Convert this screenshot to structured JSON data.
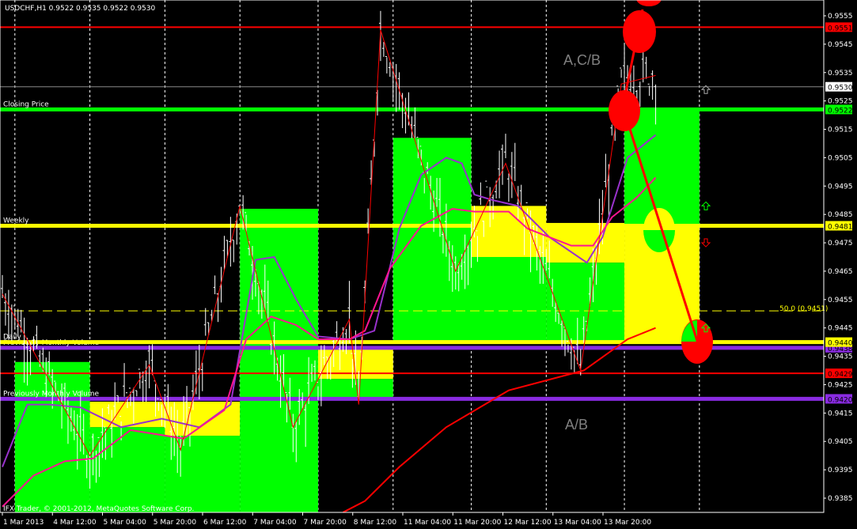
{
  "window": {
    "symbol_info": "USDCHF,H1  0.9522 0.9535 0.9522 0.9530",
    "copyright": "IFX Trader, © 2001-2012, MetaQuotes Software Corp."
  },
  "chart_data": {
    "type": "candlestick-bars",
    "symbol": "USDCHF",
    "timeframe": "H1",
    "ohlc_current": {
      "open": 0.9522,
      "high": 0.9535,
      "low": 0.9522,
      "close": 0.953
    },
    "ylim": [
      0.938,
      0.956
    ],
    "y_ticks": [
      "0.9555",
      "0.9545",
      "0.9535",
      "0.9525",
      "0.9515",
      "0.9505",
      "0.9495",
      "0.9485",
      "0.9475",
      "0.9465",
      "0.9455",
      "0.9445",
      "0.9435",
      "0.9425",
      "0.9415",
      "0.9405",
      "0.9395",
      "0.9385"
    ],
    "x_ticks": [
      "1 Mar 2013",
      "4 Mar 12:00",
      "5 Mar 04:00",
      "5 Mar 20:00",
      "6 Mar 12:00",
      "7 Mar 04:00",
      "7 Mar 20:00",
      "8 Mar 12:00",
      "11 Mar 04:00",
      "11 Mar 20:00",
      "12 Mar 12:00",
      "13 Mar 04:00",
      "13 Mar 20:00"
    ],
    "levels": [
      {
        "name": "resistance",
        "price": 0.9551,
        "label": "0.9551",
        "color": "#ff0000",
        "width": 2
      },
      {
        "name": "current-price",
        "price": 0.953,
        "label": "0.9530",
        "color": "#8a8a8a",
        "width": 1
      },
      {
        "name": "closing-price",
        "price": 0.9522,
        "label": "0.9522",
        "color": "#00ff00",
        "width": 5,
        "text": "Closing Price"
      },
      {
        "name": "weekly",
        "price": 0.9481,
        "label": "0.9481",
        "color": "#ffff00",
        "width": 5,
        "text": "Weekly"
      },
      {
        "name": "previous-monthly-volume-1",
        "price": 0.9438,
        "label": "0.9438",
        "color": "#8a2be2",
        "width": 5,
        "text": "Previously Monthly Volume"
      },
      {
        "name": "daily",
        "price": 0.944,
        "label": "0.9440",
        "color": "#ffff00",
        "width": 5,
        "text": "Daily"
      },
      {
        "name": "support",
        "price": 0.9429,
        "label": "0.9429",
        "color": "#ff0000",
        "width": 2
      },
      {
        "name": "previous-monthly-volume-2",
        "price": 0.942,
        "label": "0.9420",
        "color": "#8a2be2",
        "width": 5,
        "text": "Previously Monthly Volume"
      }
    ],
    "fibo": {
      "price": 0.9451,
      "label": "50.0 (0.9451)"
    },
    "boxes": [
      {
        "b0": 4,
        "b1": 28,
        "top": 0.9433,
        "bottom": 0.938,
        "color": "#00ff00"
      },
      {
        "b0": 28,
        "b1": 52,
        "top": 0.9419,
        "bottom": 0.941,
        "color": "#ffff00"
      },
      {
        "b0": 28,
        "b1": 52,
        "top": 0.941,
        "bottom": 0.938,
        "color": "#00ff00"
      },
      {
        "b0": 52,
        "b1": 76,
        "top": 0.9419,
        "bottom": 0.9407,
        "color": "#ffff00"
      },
      {
        "b0": 52,
        "b1": 76,
        "top": 0.9407,
        "bottom": 0.938,
        "color": "#00ff00"
      },
      {
        "b0": 76,
        "b1": 101,
        "top": 0.9487,
        "bottom": 0.938,
        "color": "#00ff00"
      },
      {
        "b0": 101,
        "b1": 125,
        "top": 0.9438,
        "bottom": 0.9427,
        "color": "#ffff00"
      },
      {
        "b0": 101,
        "b1": 125,
        "top": 0.9427,
        "bottom": 0.942,
        "color": "#00ff00"
      },
      {
        "b0": 125,
        "b1": 150,
        "top": 0.9512,
        "bottom": 0.944,
        "color": "#00ff00"
      },
      {
        "b0": 150,
        "b1": 174,
        "top": 0.9488,
        "bottom": 0.947,
        "color": "#ffff00"
      },
      {
        "b0": 150,
        "b1": 174,
        "top": 0.947,
        "bottom": 0.944,
        "color": "#00ff00"
      },
      {
        "b0": 174,
        "b1": 199,
        "top": 0.9482,
        "bottom": 0.9468,
        "color": "#ffff00"
      },
      {
        "b0": 174,
        "b1": 199,
        "top": 0.9468,
        "bottom": 0.944,
        "color": "#00ff00"
      },
      {
        "b0": 199,
        "b1": 223,
        "top": 0.9522,
        "bottom": 0.9481,
        "color": "#00ff00"
      },
      {
        "b0": 199,
        "b1": 223,
        "top": 0.9481,
        "bottom": 0.944,
        "color": "#ffff00"
      }
    ],
    "zigzag": [
      [
        0,
        0.9457
      ],
      [
        28,
        0.94
      ],
      [
        47,
        0.9432
      ],
      [
        57,
        0.9402
      ],
      [
        76,
        0.9488
      ],
      [
        93,
        0.941
      ],
      [
        111,
        0.9448
      ],
      [
        114,
        0.9418
      ],
      [
        121,
        0.955
      ],
      [
        145,
        0.9465
      ],
      [
        161,
        0.9503
      ],
      [
        185,
        0.943
      ],
      [
        198,
        0.9531
      ],
      [
        209,
        0.9534
      ]
    ],
    "series": [
      {
        "name": "ma-fast",
        "color": "#9932cc",
        "points": [
          [
            0,
            0.9396
          ],
          [
            8,
            0.9418
          ],
          [
            15,
            0.9418
          ],
          [
            25,
            0.9417
          ],
          [
            38,
            0.941
          ],
          [
            51,
            0.9413
          ],
          [
            63,
            0.941
          ],
          [
            73,
            0.9418
          ],
          [
            81,
            0.9469
          ],
          [
            87,
            0.947
          ],
          [
            94,
            0.9455
          ],
          [
            101,
            0.9442
          ],
          [
            111,
            0.9441
          ],
          [
            119,
            0.9444
          ],
          [
            127,
            0.948
          ],
          [
            134,
            0.9499
          ],
          [
            142,
            0.9505
          ],
          [
            147,
            0.9503
          ],
          [
            151,
            0.9492
          ],
          [
            157,
            0.949
          ],
          [
            165,
            0.9488
          ],
          [
            175,
            0.9477
          ],
          [
            187,
            0.9468
          ],
          [
            192,
            0.9477
          ],
          [
            200,
            0.9505
          ],
          [
            209,
            0.9513
          ]
        ]
      },
      {
        "name": "ma-medium",
        "color": "#ff1493",
        "points": [
          [
            0,
            0.9382
          ],
          [
            10,
            0.9393
          ],
          [
            20,
            0.9398
          ],
          [
            29,
            0.9399
          ],
          [
            41,
            0.9409
          ],
          [
            58,
            0.9406
          ],
          [
            71,
            0.9416
          ],
          [
            78,
            0.9441
          ],
          [
            86,
            0.9449
          ],
          [
            94,
            0.9446
          ],
          [
            101,
            0.9441
          ],
          [
            111,
            0.9441
          ],
          [
            116,
            0.9444
          ],
          [
            124,
            0.9466
          ],
          [
            134,
            0.9481
          ],
          [
            144,
            0.9487
          ],
          [
            151,
            0.9486
          ],
          [
            162,
            0.9486
          ],
          [
            168,
            0.948
          ],
          [
            182,
            0.9474
          ],
          [
            189,
            0.9474
          ],
          [
            195,
            0.9484
          ],
          [
            203,
            0.9491
          ],
          [
            209,
            0.9498
          ]
        ]
      },
      {
        "name": "ma-slow",
        "color": "#ff0000",
        "points": [
          [
            109,
            0.938
          ],
          [
            116,
            0.9384
          ],
          [
            127,
            0.9396
          ],
          [
            142,
            0.941
          ],
          [
            162,
            0.9423
          ],
          [
            186,
            0.943
          ],
          [
            200,
            0.9441
          ],
          [
            209,
            0.9445
          ]
        ]
      }
    ],
    "annotations": [
      {
        "text": "A,C/B"
      },
      {
        "text": "A/B"
      }
    ],
    "signals": [
      {
        "type": "up",
        "price": 0.9529,
        "color": "#aaaaaa"
      },
      {
        "type": "up",
        "price": 0.9488,
        "color": "#00ff00"
      },
      {
        "type": "down",
        "price": 0.9475,
        "color": "#ff0000"
      },
      {
        "type": "up",
        "price": 0.9445,
        "color": "#00ff00"
      }
    ]
  }
}
